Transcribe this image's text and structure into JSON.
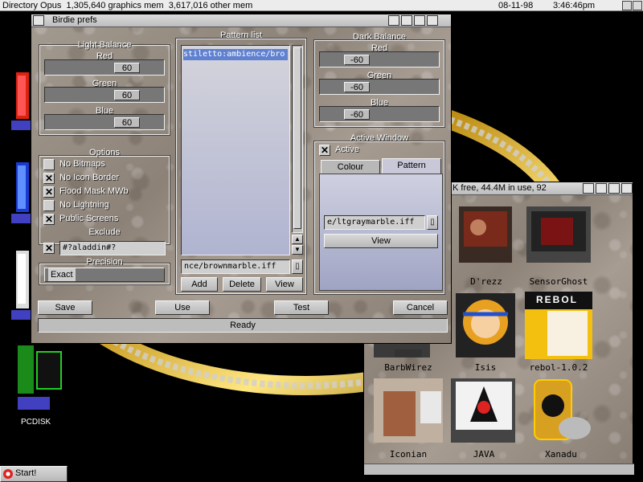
{
  "screen_title": {
    "app": "Directory Opus",
    "graphics": "1,305,640 graphics mem",
    "other": "3,617,016 other mem",
    "date": "08-11-98",
    "time": "3:46:46pm"
  },
  "desktop": {
    "icons": [
      {
        "label": "PCDISK"
      }
    ],
    "start_label": "Start!"
  },
  "file_window": {
    "title_fragment": "K free, 44.4M in use, 92",
    "items": [
      {
        "label": "D'rezz"
      },
      {
        "label": "SensorGhost"
      },
      {
        "label": "BarbWirez"
      },
      {
        "label": "Isis"
      },
      {
        "label": "rebol-1.0.2"
      },
      {
        "label": "Iconian"
      },
      {
        "label": "JAVA"
      },
      {
        "label": "Xanadu"
      }
    ],
    "rebol_badge": "REBOL"
  },
  "prefs": {
    "title": "Birdie prefs",
    "light_balance": {
      "title": "Light Balance",
      "red_label": "Red",
      "red_value": "60",
      "red_level": 0.75,
      "green_label": "Green",
      "green_value": "60",
      "green_level": 0.75,
      "blue_label": "Blue",
      "blue_value": "60",
      "blue_level": 0.75
    },
    "options": {
      "title": "Options",
      "items": [
        {
          "label": "No Bitmaps",
          "checked": false
        },
        {
          "label": "No Icon Border",
          "checked": true
        },
        {
          "label": "Flood Mask MWb",
          "checked": true
        },
        {
          "label": "No Lightning",
          "checked": false
        },
        {
          "label": "Public Screens",
          "checked": true
        }
      ],
      "exclude_label": "Exclude",
      "exclude_checked": true,
      "exclude_value": "#?aladdin#?"
    },
    "precision": {
      "title": "Precision",
      "value": "Exact"
    },
    "pattern_list": {
      "title": "Pattern list",
      "items": [
        "stiletto:ambience/bro"
      ],
      "file_value": "nce/brownmarble.iff",
      "add_label": "Add",
      "delete_label": "Delete",
      "view_label": "View"
    },
    "dark_balance": {
      "title": "Dark Balance",
      "red_label": "Red",
      "red_value": "-60",
      "red_level": 0.25,
      "green_label": "Green",
      "green_value": "-60",
      "green_level": 0.25,
      "blue_label": "Blue",
      "blue_value": "-60",
      "blue_level": 0.25
    },
    "active_window": {
      "title": "Active Window",
      "active_label": "Active",
      "active_checked": true,
      "tabs": [
        {
          "label": "Colour",
          "selected": false
        },
        {
          "label": "Pattern",
          "selected": true
        }
      ],
      "file_value": "e/ltgraymarble.iff",
      "view_label": "View"
    },
    "buttons": {
      "save": "Save",
      "use": "Use",
      "test": "Test",
      "cancel": "Cancel"
    },
    "status": "Ready"
  }
}
